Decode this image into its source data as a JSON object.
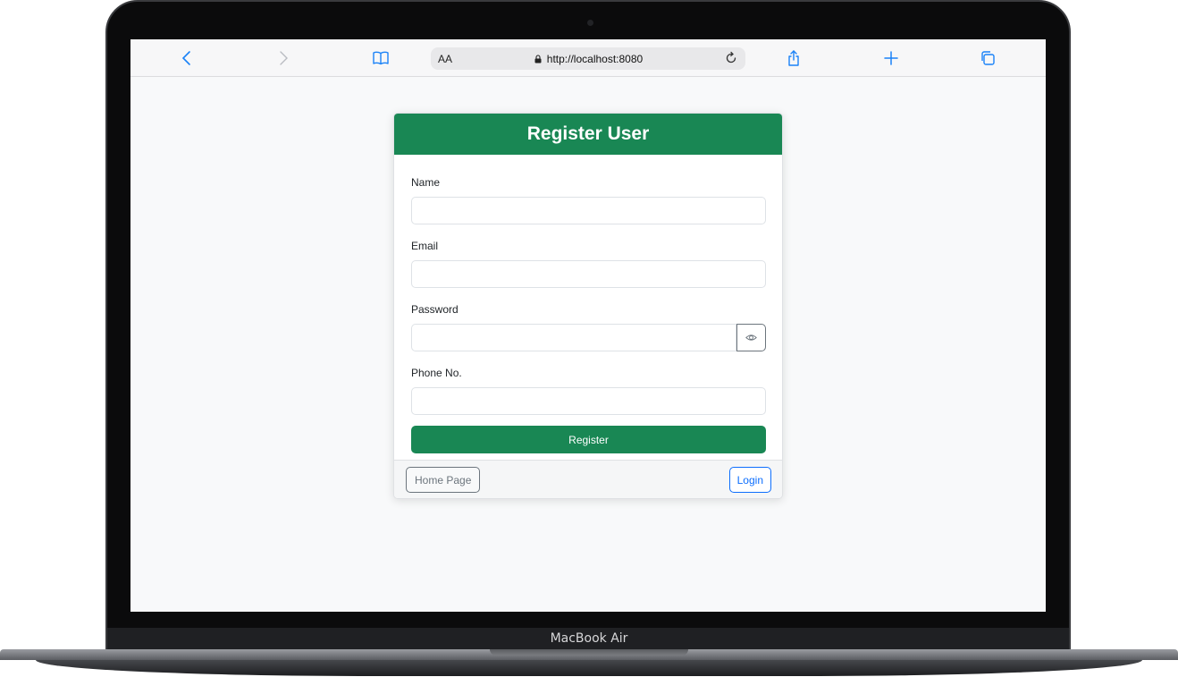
{
  "device": {
    "label": "MacBook Air"
  },
  "browser": {
    "text_size_label": "AA",
    "url": "http://localhost:8080",
    "icons": {
      "back": "chevron-left-icon",
      "forward": "chevron-right-icon",
      "bookmarks": "book-icon",
      "reload": "reload-icon",
      "share": "share-icon",
      "new_tab": "plus-icon",
      "tabs": "tabs-icon"
    },
    "accent": "#1a82f7"
  },
  "form": {
    "title": "Register User",
    "fields": {
      "name_label": "Name",
      "name_value": "",
      "email_label": "Email",
      "email_value": "",
      "password_label": "Password",
      "password_value": "",
      "phone_label": "Phone No.",
      "phone_value": ""
    },
    "password_toggle_icon": "eye-icon",
    "submit_label": "Register",
    "primary_color": "#198754"
  },
  "footer": {
    "home_label": "Home Page",
    "login_label": "Login",
    "login_color": "#0d6efd"
  }
}
